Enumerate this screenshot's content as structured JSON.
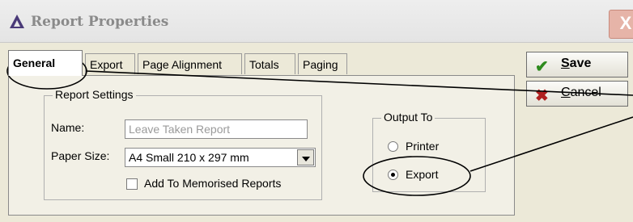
{
  "window": {
    "title": "Report Properties",
    "close_label": "X"
  },
  "tabs": [
    {
      "label": "General",
      "active": true
    },
    {
      "label": "Export"
    },
    {
      "label": "Page Alignment"
    },
    {
      "label": "Totals"
    },
    {
      "label": "Paging"
    }
  ],
  "report_settings": {
    "group_label": "Report Settings",
    "name_label": "Name:",
    "name_value": "Leave Taken Report",
    "paper_size_label": "Paper Size:",
    "paper_size_value": "A4 Small 210 x 297 mm",
    "memorised_label": "Add To Memorised Reports",
    "memorised_checked": false
  },
  "output_to": {
    "group_label": "Output To",
    "options": [
      {
        "label": "Printer",
        "selected": false
      },
      {
        "label": "Export",
        "selected": true
      }
    ]
  },
  "buttons": {
    "save_label": "Save",
    "cancel_label": "Cancel"
  },
  "colors": {
    "save_icon": "#2e8b1e",
    "cancel_icon": "#b02020",
    "annotation": "#000000"
  }
}
